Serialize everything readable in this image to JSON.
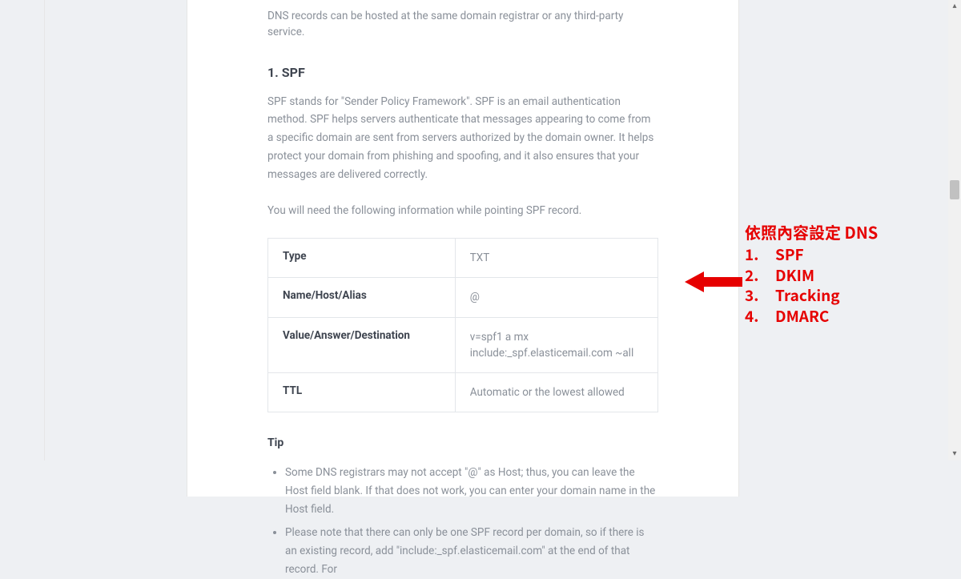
{
  "intro": "DNS records can be hosted at the same domain registrar or any third-party service.",
  "section1": {
    "heading": "1. SPF",
    "p1": "SPF stands for \"Sender Policy Framework\". SPF is an email authentication method. SPF helps servers authenticate that messages appearing to come from a specific domain are sent from servers authorized by the domain owner. It helps protect your domain from phishing and spoofing, and it also ensures that your messages are delivered correctly.",
    "p2": "You will need the following information while pointing SPF record."
  },
  "table": {
    "rows": [
      {
        "label": "Type",
        "value": "TXT"
      },
      {
        "label": "Name/Host/Alias",
        "value": "@"
      },
      {
        "label": "Value/Answer/Destination",
        "value": "v=spf1 a mx include:_spf.elasticemail.com ~all"
      },
      {
        "label": "TTL",
        "value": "Automatic or the lowest allowed"
      }
    ]
  },
  "tip": {
    "heading": "Tip",
    "items": [
      "Some DNS registrars may not accept \"@\" as Host; thus, you can leave the Host field blank. If that does not work, you can enter your domain name in the Host field.",
      "Please note that there can only be one SPF record per domain, so if there is an existing record, add \"include:_spf.elasticemail.com\" at the end of that record. For"
    ]
  },
  "annotation": {
    "title": "依照內容設定 DNS",
    "items": [
      {
        "num": "1.",
        "txt": "SPF"
      },
      {
        "num": "2.",
        "txt": "DKIM"
      },
      {
        "num": "3.",
        "txt": "Tracking"
      },
      {
        "num": "4.",
        "txt": "DMARC"
      }
    ],
    "color": "#e60000"
  }
}
